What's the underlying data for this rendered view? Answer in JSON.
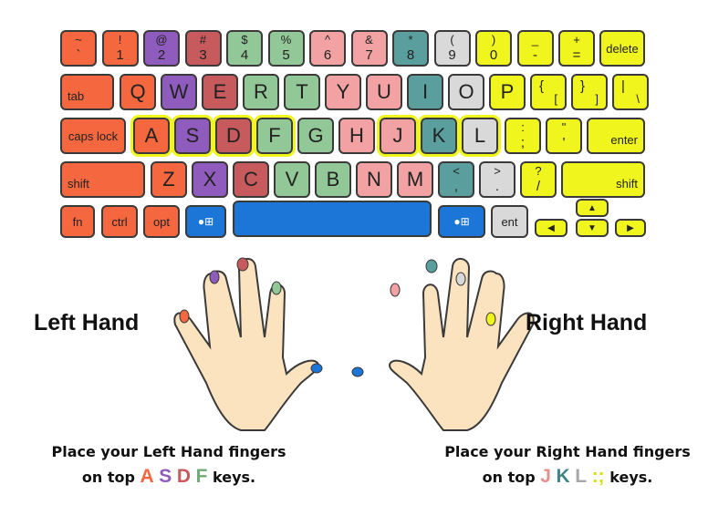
{
  "colors": {
    "orange": "#f4673f",
    "purple": "#8f5bbd",
    "red": "#c65a5c",
    "green": "#92c797",
    "pink": "#f2a2a3",
    "teal": "#5a9e9e",
    "gray": "#d9d9d9",
    "yellow": "#f0f51d",
    "blue": "#1b76d8",
    "skin": "#fce3bf",
    "outline": "#3a3a3a"
  },
  "keyboard": {
    "number_row": [
      {
        "top": "~",
        "bot": "`"
      },
      {
        "top": "!",
        "bot": "1"
      },
      {
        "top": "@",
        "bot": "2"
      },
      {
        "top": "#",
        "bot": "3"
      },
      {
        "top": "$",
        "bot": "4"
      },
      {
        "top": "%",
        "bot": "5"
      },
      {
        "top": "^",
        "bot": "6"
      },
      {
        "top": "&",
        "bot": "7"
      },
      {
        "top": "*",
        "bot": "8"
      },
      {
        "top": "(",
        "bot": "9"
      },
      {
        "top": ")",
        "bot": "0"
      },
      {
        "top": "_",
        "bot": "-"
      },
      {
        "top": "+",
        "bot": "="
      }
    ],
    "delete_label": "delete",
    "tab_label": "tab",
    "qwerty_row": [
      "Q",
      "W",
      "E",
      "R",
      "T",
      "Y",
      "U",
      "I",
      "O",
      "P"
    ],
    "bracket_keys": [
      {
        "top": "{",
        "bot": "["
      },
      {
        "top": "}",
        "bot": "]"
      },
      {
        "top": "|",
        "bot": "\\"
      }
    ],
    "caps_label": "caps lock",
    "home_row": [
      "A",
      "S",
      "D",
      "F",
      "G",
      "H",
      "J",
      "K",
      "L"
    ],
    "home_punct": [
      {
        "top": ":",
        "bot": ";"
      },
      {
        "top": "\"",
        "bot": "'"
      }
    ],
    "enter_label": "enter",
    "shift_label": "shift",
    "bottom_letters": [
      "Z",
      "X",
      "C",
      "V",
      "B",
      "N",
      "M"
    ],
    "bottom_punct": [
      {
        "top": "<",
        "bot": ","
      },
      {
        "top": ">",
        "bot": "."
      },
      {
        "top": "?",
        "bot": "/"
      }
    ],
    "fn_label": "fn",
    "ctrl_label": "ctrl",
    "opt_label": "opt",
    "cmd_label": "●⊞",
    "ent_label": "ent",
    "arrows": {
      "up": "▲",
      "down": "▼",
      "left": "◀",
      "right": "▶"
    }
  },
  "hands": {
    "left_label": "Left Hand",
    "right_label": "Right Hand"
  },
  "instructions": {
    "left_line1": "Place your Left Hand fingers",
    "left_prefix": "on top",
    "left_keys": [
      "A",
      "S",
      "D",
      "F"
    ],
    "left_suffix": "keys.",
    "right_line1": "Place your Right Hand fingers",
    "right_prefix": "on top",
    "right_keys": [
      "J",
      "K",
      "L",
      ":;"
    ],
    "right_suffix": "keys."
  }
}
